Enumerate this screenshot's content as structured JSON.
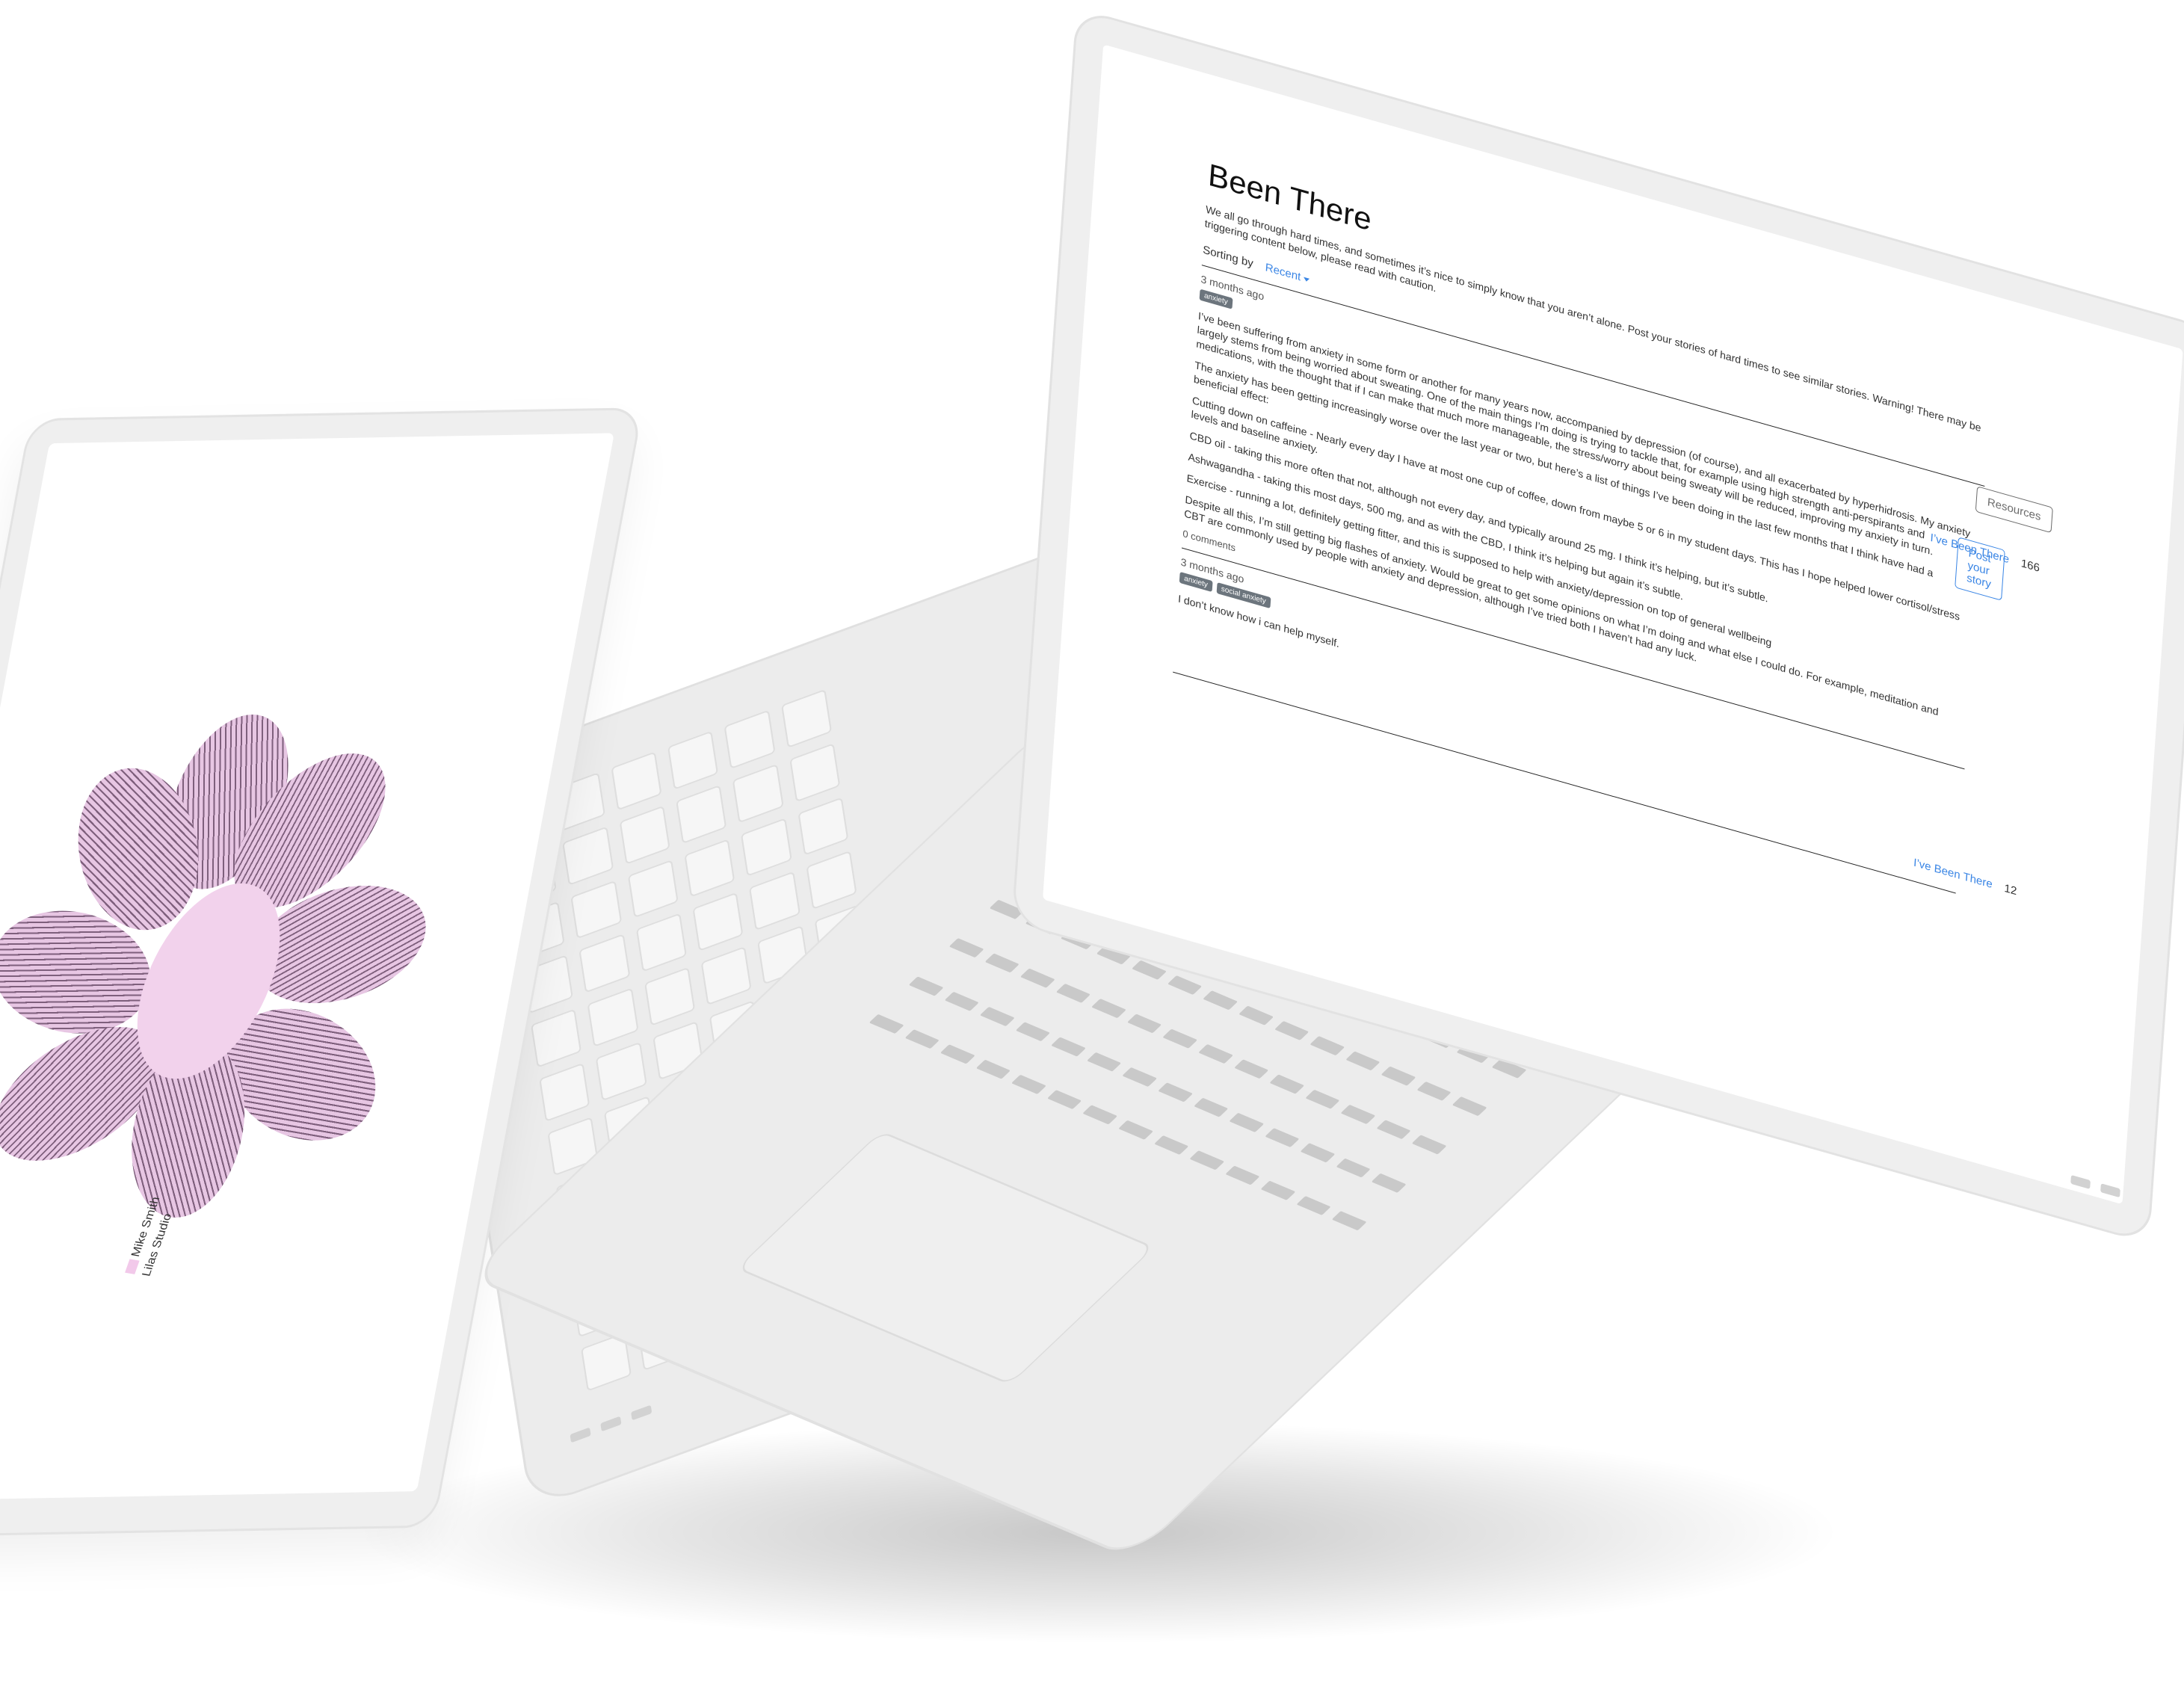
{
  "app": {
    "title": "Been There",
    "intro": "We all go through hard times, and sometimes it’s nice to simply know that you aren’t alone. Post your stories of hard times to see similar stories. Warning! There may be triggering content below, please read with caution.",
    "sorting_label": "Sorting by",
    "sorting_value": "Recent",
    "resources_button": "Resources",
    "post_button": "Post your story"
  },
  "stories": [
    {
      "time": "3 months ago",
      "tags": [
        "anxiety"
      ],
      "paragraphs": [
        "I’ve been suffering from anxiety in some form or another for many years now, accompanied by depression (of course), and all exacerbated by hyperhidrosis. My anxiety largely stems from being worried about sweating. One of the main things I’m doing is trying to tackle that, for example using high strength anti-perspirants and medications, with the thought that if I can make that much more manageable, the stress/worry about being sweaty will be reduced, improving my anxiety in turn.",
        "The anxiety has been getting increasingly worse over the last year or two, but here’s a list of things I’ve been doing in the last few months that I think have had a beneficial effect:",
        "Cutting down on caffeine - Nearly every day I have at most one cup of coffee, down from maybe 5 or 6 in my student days. This has I hope helped lower cortisol/stress levels and baseline anxiety.",
        "CBD oil - taking this more often that not, although not every day, and typically around 25 mg. I think it’s helping, but it’s subtle.",
        "Ashwagandha - taking this most days, 500 mg, and as with the CBD, I think it’s helping but again it’s subtle.",
        "Exercise - running a lot, definitely getting fitter, and this is supposed to help with anxiety/depression on top of general wellbeing",
        "Despite all this, I’m still getting big flashes of anxiety. Would be great to get some opinions on what I’m doing and what else I could do. For example, meditation and CBT are commonly used by people with anxiety and depression, although I’ve tried both I haven’t had any luck."
      ],
      "comments": "0 comments",
      "been_there_label": "I’ve Been There",
      "been_there_count": "166"
    },
    {
      "time": "3 months ago",
      "tags": [
        "anxiety",
        "social anxiety"
      ],
      "paragraphs": [
        "I don’t know how i can help myself."
      ],
      "been_there_label": "I’ve Been There",
      "been_there_count": "12"
    }
  ],
  "left_screen": {
    "caption_line1": "Mike Smith",
    "caption_line2": "Lilas Studio"
  },
  "colors": {
    "accent": "#3b86e5",
    "tag_bg": "#6c757d",
    "petal": "#e7c6e3",
    "device": "#ececec"
  }
}
